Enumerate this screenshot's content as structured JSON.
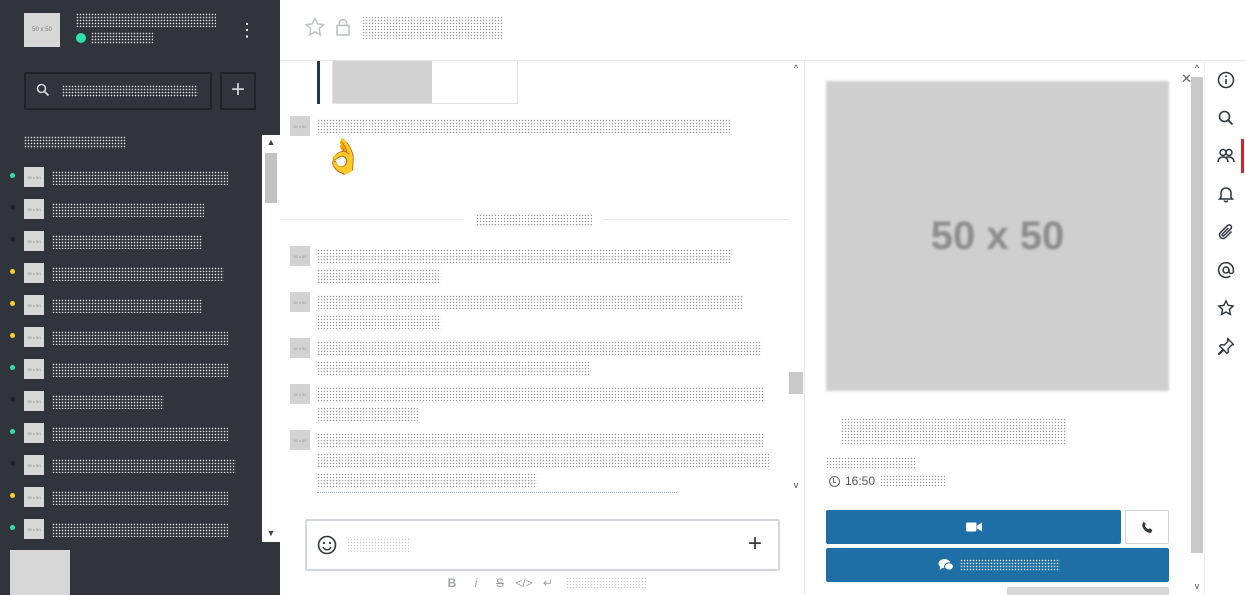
{
  "sidebar": {
    "avatar_text": "50 x 50",
    "user_name": "",
    "status_text": "",
    "search_placeholder": "",
    "section_title": "",
    "items": [
      {
        "status": "online",
        "avatar_text": "50 x 50",
        "name_width": 176
      },
      {
        "status": "offline",
        "avatar_text": "50 x 50",
        "name_width": 152
      },
      {
        "status": "offline",
        "avatar_text": "50 x 50",
        "name_width": 150
      },
      {
        "status": "away",
        "avatar_text": "50 x 50",
        "name_width": 172
      },
      {
        "status": "away",
        "avatar_text": "50 x 50",
        "name_width": 150
      },
      {
        "status": "away",
        "avatar_text": "50 x 50",
        "name_width": 176
      },
      {
        "status": "online",
        "avatar_text": "50 x 50",
        "name_width": 176
      },
      {
        "status": "offline",
        "avatar_text": "50 x 50",
        "name_width": 112
      },
      {
        "status": "online",
        "avatar_text": "50 x 50",
        "name_width": 176
      },
      {
        "status": "offline",
        "avatar_text": "50 x 50",
        "name_width": 184
      },
      {
        "status": "away",
        "avatar_text": "50 x 50",
        "name_width": 176
      },
      {
        "status": "online",
        "avatar_text": "50 x 50",
        "name_width": 176
      }
    ]
  },
  "header": {
    "room_title": ""
  },
  "messages": {
    "emoji": "👌",
    "divider_label": "",
    "avatar_text": "50 x 50"
  },
  "composer": {
    "placeholder": "",
    "formatting": [
      "B",
      "i",
      "S",
      "</>",
      "↵"
    ],
    "formatting_help": ""
  },
  "contextual": {
    "avatar_text": "50 x 50",
    "name": "",
    "username": "",
    "local_time": "16:50",
    "local_time_suffix": "",
    "chat_label": ""
  },
  "toolbar": {
    "items": [
      "info-icon",
      "search-icon",
      "members-icon",
      "bell-icon",
      "paperclip-icon",
      "mention-icon",
      "star-icon",
      "pin-icon"
    ],
    "active": "members-icon"
  },
  "colors": {
    "sidebar_bg": "#2f343d",
    "online": "#2de0a5",
    "away": "#ffd21f",
    "offline": "#1f2329",
    "primary": "#1d6fa5",
    "active_indicator": "#e01f2d"
  }
}
